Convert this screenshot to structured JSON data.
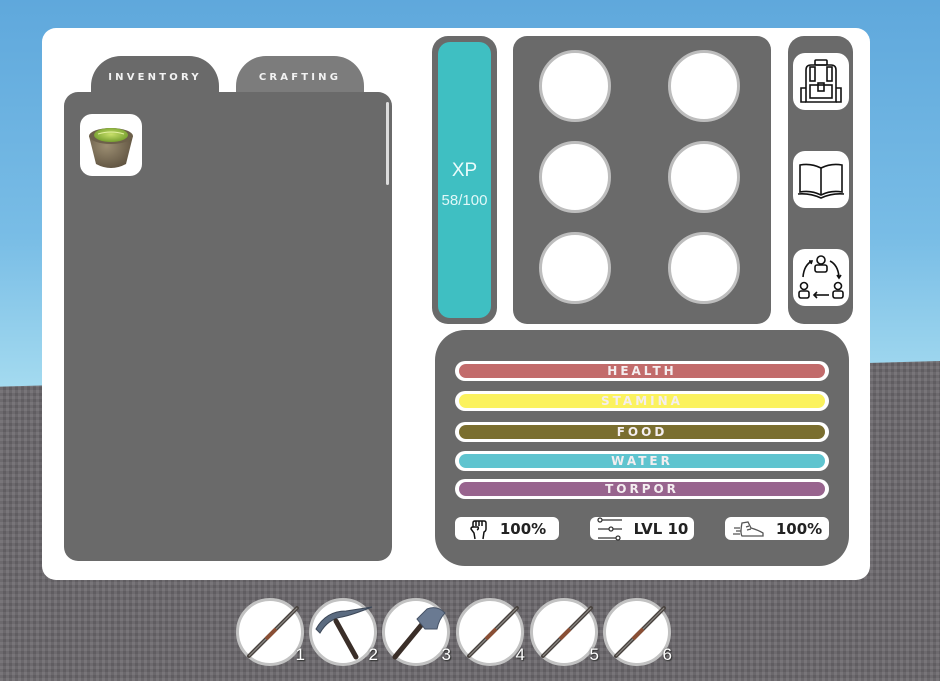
{
  "tabs": [
    {
      "label": "INVENTORY",
      "active": true
    },
    {
      "label": "CRAFTING",
      "active": false
    }
  ],
  "inventory": {
    "items": [
      {
        "name": "bowl-with-food",
        "icon": "bowl-icon"
      }
    ]
  },
  "xp": {
    "label": "XP",
    "value": "58/100",
    "current": 58,
    "max": 100,
    "color": "#3fbfc2"
  },
  "equipment_slots": [
    {
      "slot": 1,
      "filled": false
    },
    {
      "slot": 2,
      "filled": false
    },
    {
      "slot": 3,
      "filled": false
    },
    {
      "slot": 4,
      "filled": false
    },
    {
      "slot": 5,
      "filled": false
    },
    {
      "slot": 6,
      "filled": false
    }
  ],
  "side_menu": [
    {
      "name": "backpack",
      "icon": "backpack-icon"
    },
    {
      "name": "journal",
      "icon": "book-icon"
    },
    {
      "name": "social",
      "icon": "people-cycle-icon"
    }
  ],
  "status_bars": [
    {
      "label": "HEALTH",
      "fill": 1.0,
      "color": "#c26b6b"
    },
    {
      "label": "STAMINA",
      "fill": 1.0,
      "color": "#fbf25e"
    },
    {
      "label": "FOOD",
      "fill": 1.0,
      "color": "#7a6e2f"
    },
    {
      "label": "WATER",
      "fill": 1.0,
      "color": "#5fc4cf"
    },
    {
      "label": "TORPOR",
      "fill": 1.0,
      "color": "#98648e"
    }
  ],
  "stat_chips": [
    {
      "icon": "fist-icon",
      "value": "100%"
    },
    {
      "icon": "sliders-icon",
      "value": "LVL 10"
    },
    {
      "icon": "running-shoe-icon",
      "value": "100%"
    }
  ],
  "hotbar": [
    {
      "number": "1",
      "tool": "spear"
    },
    {
      "number": "2",
      "tool": "pickaxe"
    },
    {
      "number": "3",
      "tool": "axe"
    },
    {
      "number": "4",
      "tool": "spear"
    },
    {
      "number": "5",
      "tool": "spear"
    },
    {
      "number": "6",
      "tool": "spear"
    }
  ]
}
